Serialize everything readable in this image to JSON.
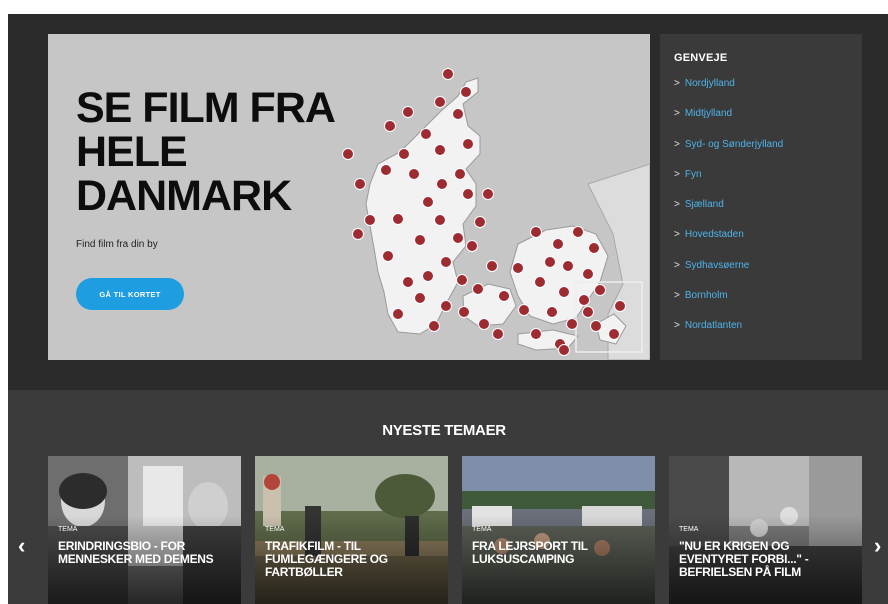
{
  "hero": {
    "title_lines": [
      "SE FILM FRA",
      "HELE",
      "DANMARK"
    ],
    "subtitle": "Find film fra din by",
    "button_label": "GÅ TIL KORTET"
  },
  "shortcuts": {
    "title": "GENVEJE",
    "items": [
      {
        "label": "Nordjylland"
      },
      {
        "label": "Midtjylland"
      },
      {
        "label": "Syd- og Sønderjylland"
      },
      {
        "label": "Fyn"
      },
      {
        "label": "Sjælland"
      },
      {
        "label": "Hovedstaden"
      },
      {
        "label": "Sydhavsøerne"
      },
      {
        "label": "Bornholm"
      },
      {
        "label": "Nordatlanten"
      }
    ],
    "chevron": ">"
  },
  "themes": {
    "title": "NYESTE TEMAER",
    "prev_icon": "‹",
    "next_icon": "›",
    "cards": [
      {
        "tag": "TEMA",
        "title": "ERINDRINGSBIO - FOR MENNESKER MED DEMENS"
      },
      {
        "tag": "TEMA",
        "title": "TRAFIKFILM - TIL FUMLEGÆNGERE OG FARTBØLLER"
      },
      {
        "tag": "TEMA",
        "title": "FRA LEJRSPORT TIL LUKSUSCAMPING"
      },
      {
        "tag": "TEMA",
        "title": "\"NU ER KRIGEN OG EVENTYRET FORBI...\" - BEFRIELSEN PÅ FILM"
      }
    ]
  },
  "colors": {
    "accent": "#1e9de0",
    "link": "#4fb3ea",
    "pin": "#9e2b32",
    "dark_band": "#2b2b2b",
    "panel": "#3a3a3a"
  }
}
